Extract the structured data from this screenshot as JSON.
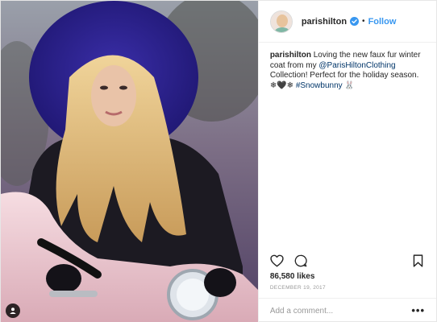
{
  "header": {
    "username": "parishilton",
    "separator": "•",
    "follow_label": "Follow"
  },
  "caption": {
    "username": "parishilton",
    "text_before": " Loving the new faux fur winter coat from my ",
    "mention": "@ParisHiltonClothing",
    "text_after": " Collection! Perfect for the holiday season. ",
    "emoji_before": "❄🖤❄ ",
    "hashtag": "#Snowbunny",
    "emoji_after": " 🐰"
  },
  "likes": "86,580 likes",
  "date": "DECEMBER 19, 2017",
  "comment": {
    "placeholder": "Add a comment...",
    "more_label": "•••"
  },
  "icons": {
    "like": "heart-icon",
    "comment": "comment-bubble-icon",
    "save": "bookmark-icon",
    "verified": "verified-badge-icon",
    "usertag": "user-tag-icon"
  },
  "colors": {
    "follow": "#3897f0",
    "link": "#003569",
    "muted": "#999999",
    "text": "#262626"
  }
}
